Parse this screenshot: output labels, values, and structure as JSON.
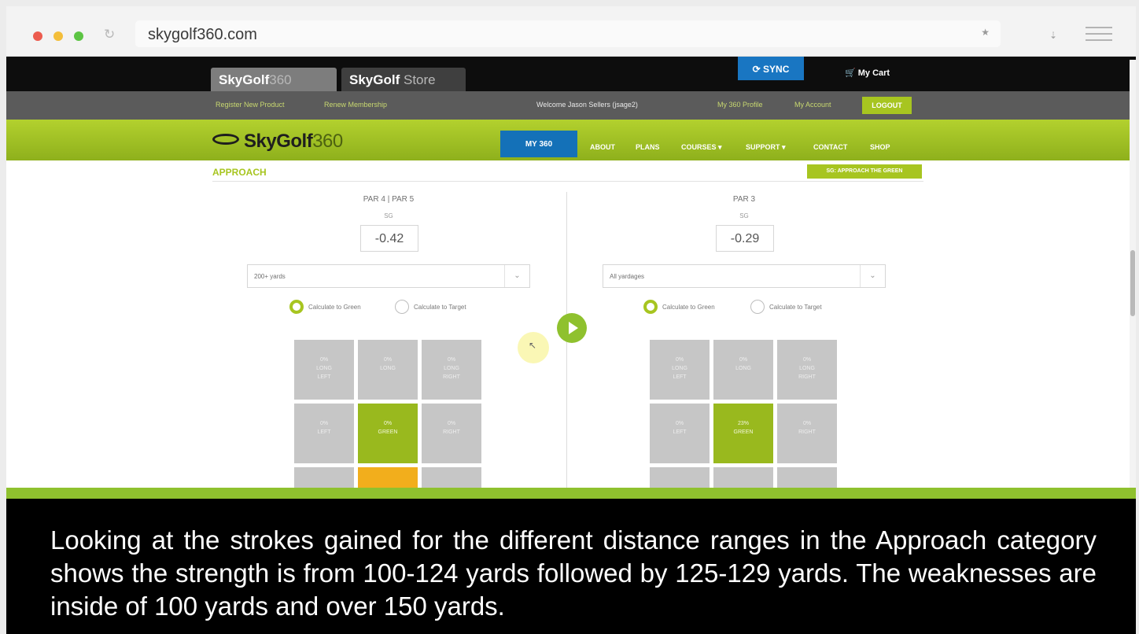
{
  "browser": {
    "url": "skygolf360.com",
    "reload_icon": "reload-icon",
    "bookmark_icon": "star-icon",
    "download_icon": "download-icon",
    "menu_icon": "hamburger-icon"
  },
  "site": {
    "tabs": [
      {
        "strong": "SkyGolf",
        "light": "360"
      },
      {
        "strong": "SkyGolf",
        "light": "Store"
      }
    ],
    "sync_label": "⟳ SYNC",
    "cart_label": "🛒 My Cart",
    "account_bar": {
      "register": "Register New Product",
      "renew": "Renew Membership",
      "welcome": "Welcome Jason Sellers (jsage2)",
      "profile": "My 360 Profile",
      "account": "My Account",
      "logout": "LOGOUT"
    },
    "logo": {
      "strong": "SkyGolf",
      "light": "360"
    },
    "nav": {
      "my360": "MY 360",
      "items": [
        "ABOUT",
        "PLANS",
        "COURSES ▾",
        "SUPPORT ▾",
        "CONTACT",
        "SHOP"
      ]
    }
  },
  "section": {
    "title": "APPROACH",
    "button": "SG: APPROACH THE GREEN"
  },
  "panels": {
    "left": {
      "title": "PAR 4 | PAR 5",
      "sg_label": "SG",
      "sg_value": "-0.42",
      "select_value": "200+ yards",
      "radio_on": "Calculate to Green",
      "radio_off": "Calculate to Target",
      "cells": [
        [
          "0%",
          "LONG",
          "LEFT"
        ],
        [
          "0%",
          "LONG",
          ""
        ],
        [
          "0%",
          "LONG",
          "RIGHT"
        ],
        [
          "0%",
          "LEFT",
          ""
        ],
        [
          "0%",
          "GREEN",
          ""
        ],
        [
          "0%",
          "RIGHT",
          ""
        ],
        [
          "",
          "",
          ""
        ],
        [
          "",
          "",
          ""
        ],
        [
          "",
          "",
          ""
        ]
      ]
    },
    "right": {
      "title": "PAR 3",
      "sg_label": "SG",
      "sg_value": "-0.29",
      "select_value": "All yardages",
      "radio_on": "Calculate to Green",
      "radio_off": "Calculate to Target",
      "cells": [
        [
          "0%",
          "LONG",
          "LEFT"
        ],
        [
          "0%",
          "LONG",
          ""
        ],
        [
          "0%",
          "LONG",
          "RIGHT"
        ],
        [
          "0%",
          "LEFT",
          ""
        ],
        [
          "23%",
          "GREEN",
          ""
        ],
        [
          "0%",
          "RIGHT",
          ""
        ],
        [
          "",
          "",
          ""
        ],
        [
          "",
          "",
          ""
        ],
        [
          "",
          "",
          ""
        ]
      ]
    }
  },
  "caption": "Looking at the strokes gained for the different distance ranges in the Approach category shows the strength is from 100-124 yards followed by 125-129 yards. The weaknesses are inside of 100 yards and over 150 yards."
}
